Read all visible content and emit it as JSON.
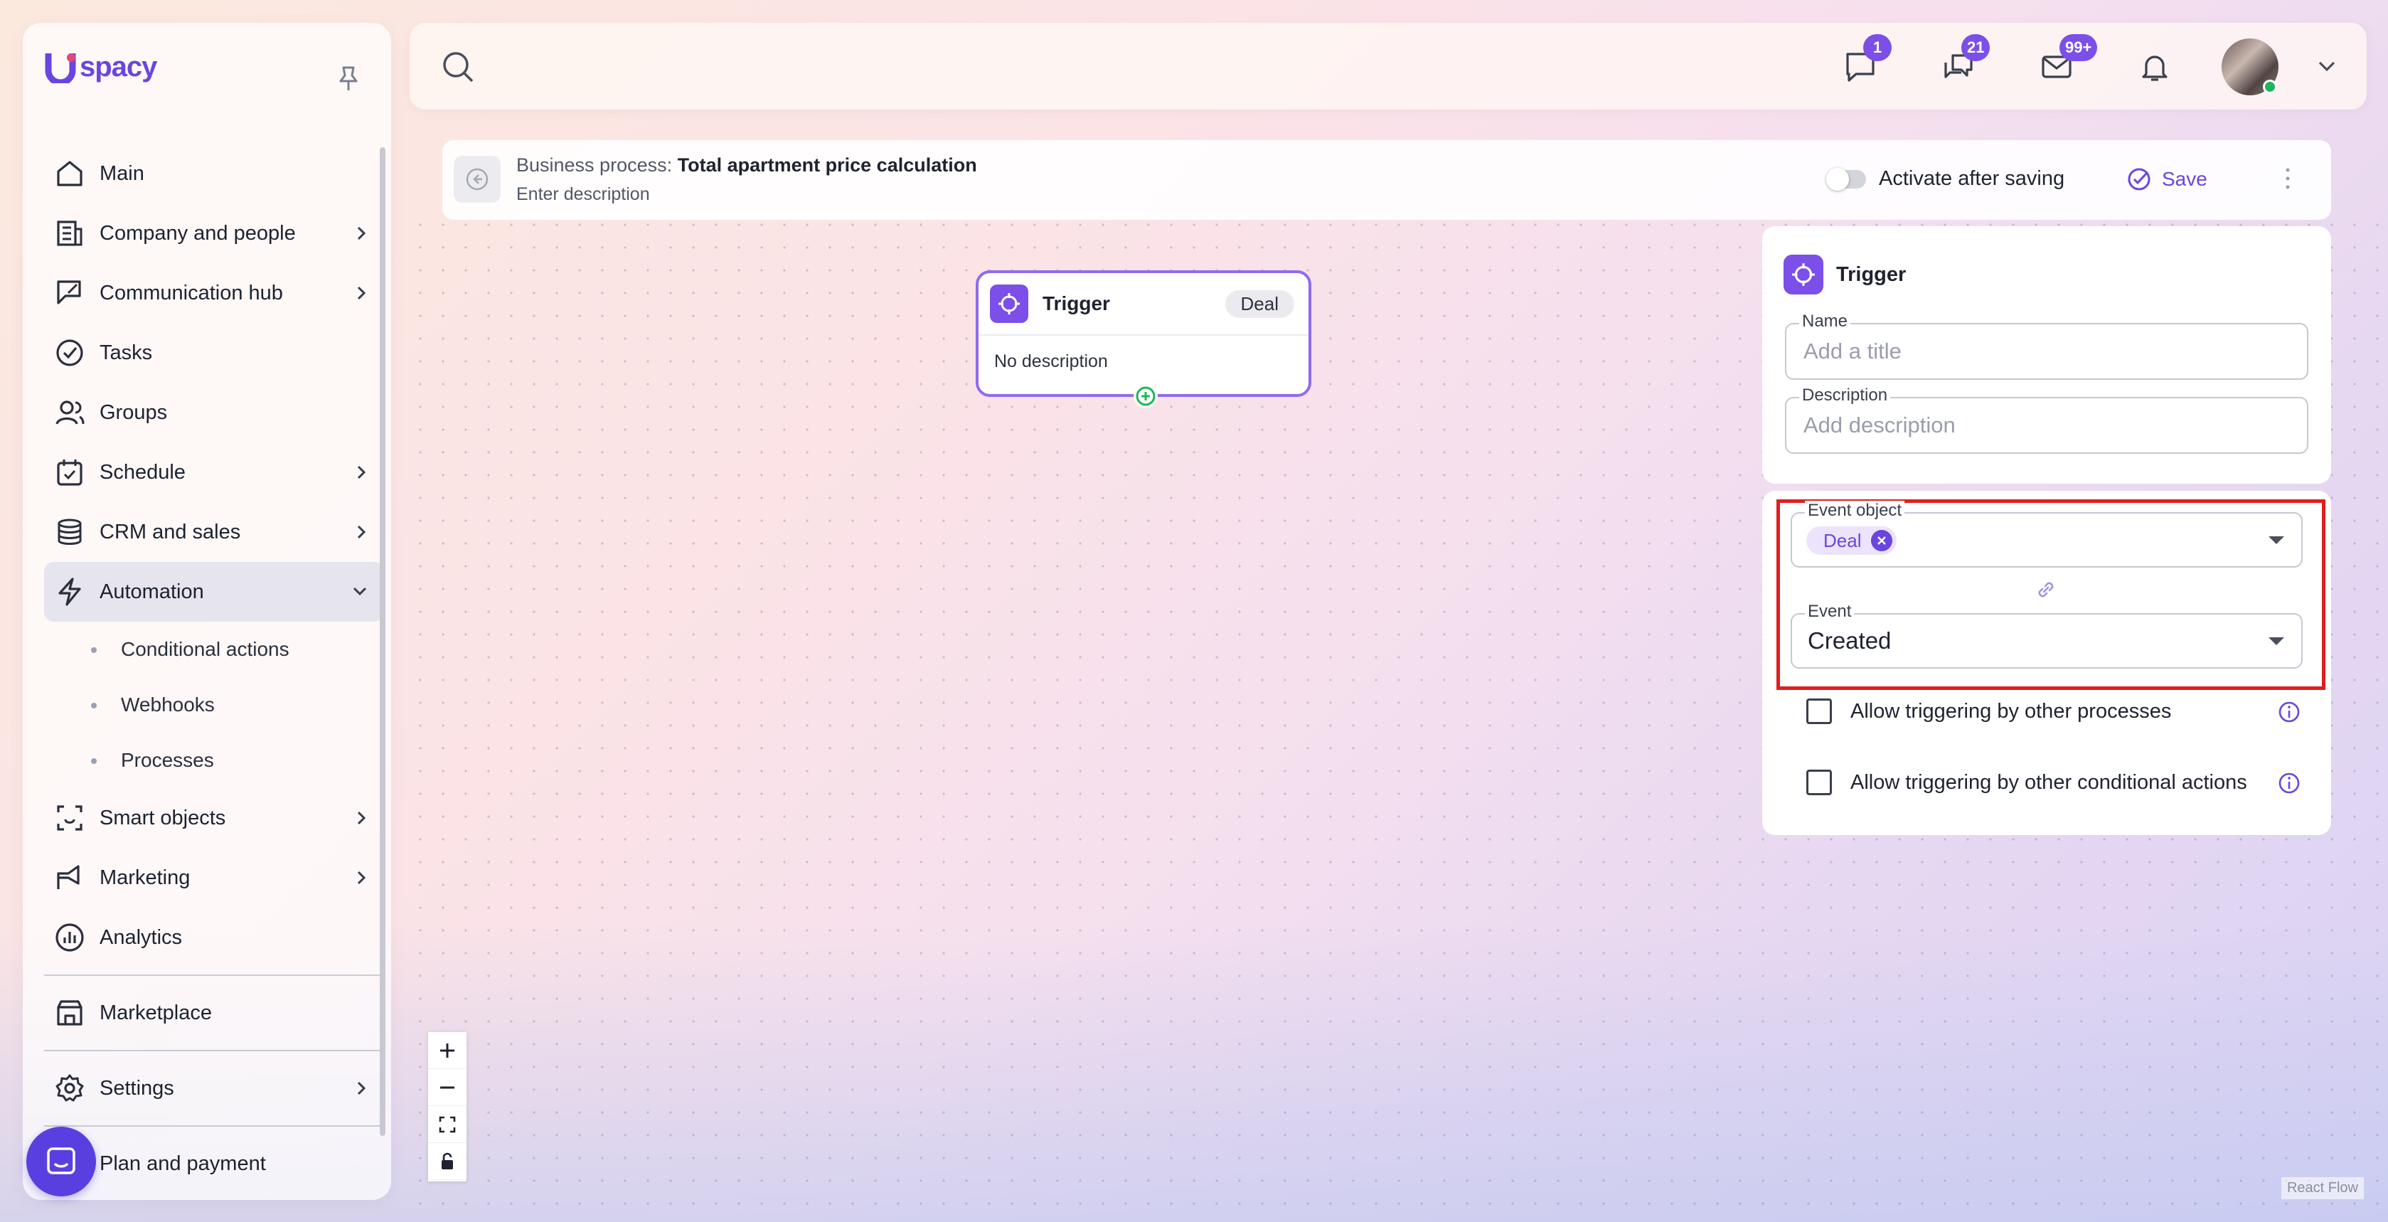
{
  "app": {
    "logo_text": "spacy",
    "brand_color": "#6a45e0"
  },
  "sidebar": {
    "items": [
      {
        "label": "Main",
        "icon": "home-icon",
        "has_chevron": false
      },
      {
        "label": "Company and people",
        "icon": "building-icon",
        "has_chevron": true
      },
      {
        "label": "Communication hub",
        "icon": "chat-edit-icon",
        "has_chevron": true
      },
      {
        "label": "Tasks",
        "icon": "check-circle-icon",
        "has_chevron": false
      },
      {
        "label": "Groups",
        "icon": "users-icon",
        "has_chevron": false
      },
      {
        "label": "Schedule",
        "icon": "calendar-icon",
        "has_chevron": true
      },
      {
        "label": "CRM and sales",
        "icon": "coins-icon",
        "has_chevron": true
      },
      {
        "label": "Automation",
        "icon": "lightning-icon",
        "has_chevron": true,
        "expanded": true
      }
    ],
    "sub_items": [
      "Conditional actions",
      "Webhooks",
      "Processes"
    ],
    "items_after": [
      {
        "label": "Smart objects",
        "icon": "scan-icon",
        "has_chevron": true
      },
      {
        "label": "Marketing",
        "icon": "megaphone-icon",
        "has_chevron": true
      },
      {
        "label": "Analytics",
        "icon": "chart-icon",
        "has_chevron": false
      }
    ],
    "marketplace": "Marketplace",
    "settings": "Settings",
    "plan": "Plan and payment"
  },
  "topbar": {
    "chat_badge": "1",
    "messages_badge": "21",
    "mail_badge": "99+"
  },
  "process": {
    "title_prefix": "Business process:",
    "title": "Total apartment price calculation",
    "description": "Enter description",
    "activate_label": "Activate after saving",
    "activate_on": false,
    "save_label": "Save"
  },
  "node": {
    "title": "Trigger",
    "chip": "Deal",
    "description": "No description"
  },
  "panel": {
    "title": "Trigger",
    "name_label": "Name",
    "name_placeholder": "Add a title",
    "description_label": "Description",
    "description_placeholder": "Add description",
    "event_object_label": "Event object",
    "event_object_value": "Deal",
    "event_label": "Event",
    "event_value": "Created",
    "checkbox1": "Allow triggering by other processes",
    "checkbox2": "Allow triggering by other conditional actions"
  },
  "footer": {
    "react_flow": "React Flow"
  }
}
